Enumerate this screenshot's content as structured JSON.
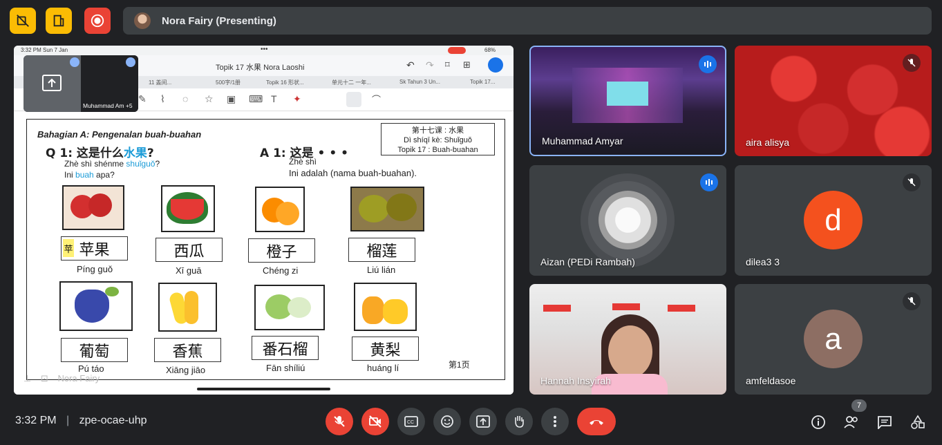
{
  "presenter": {
    "name": "Nora Fairy (Presenting)"
  },
  "screen": {
    "status_time": "3:32 PM   Sun 7 Jan",
    "status_battery": "68%",
    "doc_title": "Topik 17 水果  Nora Laoshi",
    "tabs": [
      "11 盖间...",
      "500字/1册",
      "Topik 16 形状...",
      "单元十二 一年...",
      "Sk Tahun 3 Un...",
      "Topik 17..."
    ],
    "mini_tile_name": "Muhammad Am +5",
    "watermark_name": "Nora Fairy",
    "worksheet": {
      "section_title": "Bahagian A: Pengenalan buah-buahan",
      "q1": "Q 1: 这是什么",
      "q1_word": "水果",
      "q1_mark": "?",
      "q1_pinyin_a": "Zhè shì shénme ",
      "q1_pinyin_b": "shuǐguǒ",
      "q1_pinyin_c": "?",
      "q1_malay_a": "Ini ",
      "q1_malay_b": "buah",
      "q1_malay_c": " apa?",
      "a1": "A 1: 这是 • • •",
      "a1_pinyin": "Zhè shì",
      "a1_malay": "Ini adalah (nama buah-buahan).",
      "box_line1": "第十七课 : 水果",
      "box_line2": "Dì shíqī kè: Shuǐguǒ",
      "box_line3": "Topik  17 : Buah-buahan",
      "page_number": "第1页",
      "fruits": [
        {
          "chinese": "苹果",
          "pinyin": "Píng guǒ"
        },
        {
          "chinese": "西瓜",
          "pinyin": "Xī guā"
        },
        {
          "chinese": "橙子",
          "pinyin": "Chéng zi"
        },
        {
          "chinese": "榴莲",
          "pinyin": "Liú lián"
        },
        {
          "chinese": "葡萄",
          "pinyin": "Pú táo"
        },
        {
          "chinese": "香蕉",
          "pinyin": "Xiāng jiāo"
        },
        {
          "chinese": "番石榴",
          "pinyin": "Fān shíliú"
        },
        {
          "chinese": "黄梨",
          "pinyin": "huáng lí"
        }
      ],
      "apple_highlight_char": "苹"
    }
  },
  "participants": [
    {
      "name": "Muhammad Amyar",
      "state": "speaking"
    },
    {
      "name": "aira alisya",
      "state": "muted"
    },
    {
      "name": "Aizan (PEDi Rambah)",
      "state": "speaking"
    },
    {
      "name": "dilea3 3",
      "state": "muted",
      "initial": "d",
      "color": "#f4511e"
    },
    {
      "name": "Hannah Insyirah",
      "state": "video"
    },
    {
      "name": "amfeldasoe",
      "state": "muted",
      "initial": "a",
      "color": "#8d6e63"
    }
  ],
  "footer": {
    "time": "3:32 PM",
    "separator": "|",
    "meeting_code": "zpe-ocae-uhp",
    "people_count": "7"
  },
  "colors": {
    "accent_blue": "#1a73e8",
    "danger_red": "#ea4335",
    "warning_yellow": "#fbbc04"
  }
}
